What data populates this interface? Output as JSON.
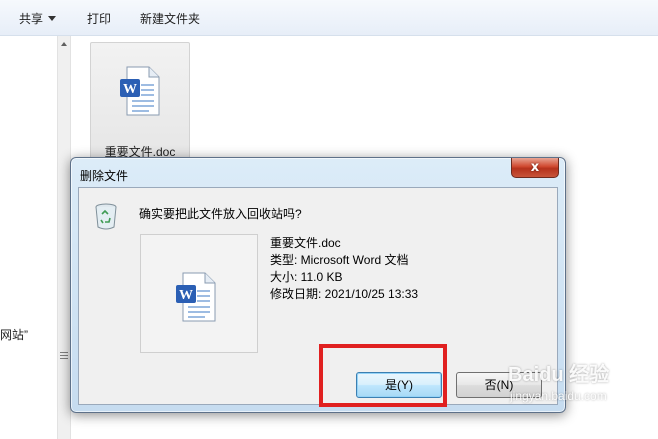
{
  "toolbar": {
    "share": "共享",
    "print": "打印",
    "new_folder": "新建文件夹"
  },
  "nav": {
    "fragment": "网站”"
  },
  "desktop_file": {
    "name": "重要文件.doc",
    "icon": "word-document-icon"
  },
  "dialog": {
    "title": "删除文件",
    "close_label": "x",
    "question": "确实要把此文件放入回收站吗?",
    "file": {
      "name": "重要文件.doc",
      "type": "类型: Microsoft Word 文档",
      "size": "大小: 11.0 KB",
      "modified": "修改日期: 2021/10/25 13:33"
    },
    "yes_label": "是(Y)",
    "no_label": "否(N)"
  },
  "watermark": {
    "main": "Baidu 经验",
    "sub": "jingyan.baidu.com"
  },
  "colors": {
    "highlight": "#e02020",
    "dialog_frame": "#c6dcf0",
    "close_button": "#c8432b"
  }
}
